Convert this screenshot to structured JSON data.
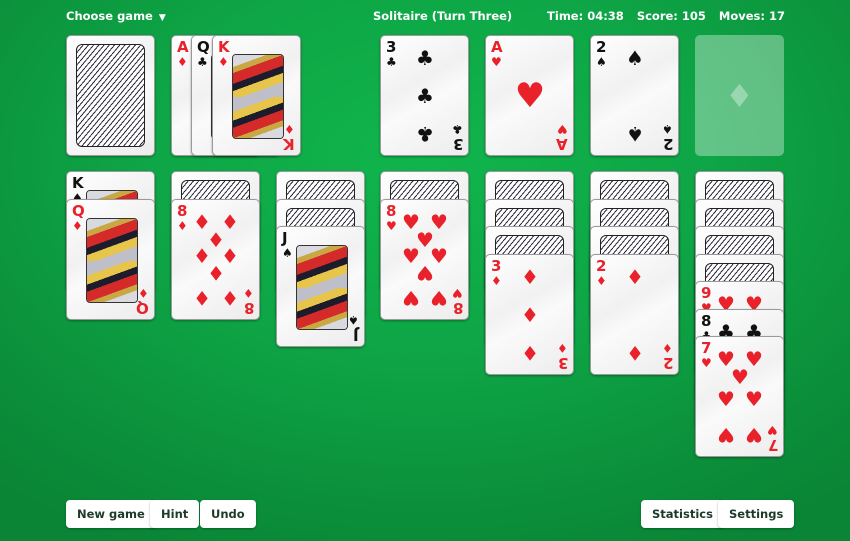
{
  "header": {
    "choose_game_label": "Choose game",
    "choose_game_arrow": "▼",
    "title": "Solitaire (Turn Three)",
    "time": "Time: 04:38",
    "score": "Score: 105",
    "moves": "Moves: 17"
  },
  "stock": {
    "face_down": true
  },
  "waste": [
    {
      "rank": "A",
      "suit": "♦",
      "color": "red"
    },
    {
      "rank": "Q",
      "suit": "♣",
      "color": "black"
    },
    {
      "rank": "K",
      "suit": "♦",
      "color": "red"
    }
  ],
  "foundations": [
    {
      "rank": "3",
      "suit": "♣",
      "color": "black"
    },
    {
      "rank": "A",
      "suit": "♥",
      "color": "red"
    },
    {
      "rank": "2",
      "suit": "♠",
      "color": "black"
    },
    {
      "empty": true,
      "placeholder_suit": "♦"
    }
  ],
  "tableau": [
    {
      "face_down": 0,
      "face_up": [
        {
          "rank": "K",
          "suit": "♠",
          "color": "black"
        },
        {
          "rank": "Q",
          "suit": "♦",
          "color": "red"
        }
      ]
    },
    {
      "face_down": 1,
      "face_up": [
        {
          "rank": "8",
          "suit": "♦",
          "color": "red"
        }
      ]
    },
    {
      "face_down": 2,
      "face_up": [
        {
          "rank": "J",
          "suit": "♠",
          "color": "black"
        }
      ]
    },
    {
      "face_down": 1,
      "face_up": [
        {
          "rank": "8",
          "suit": "♥",
          "color": "red"
        }
      ]
    },
    {
      "face_down": 3,
      "face_up": [
        {
          "rank": "3",
          "suit": "♦",
          "color": "red"
        }
      ]
    },
    {
      "face_down": 3,
      "face_up": [
        {
          "rank": "2",
          "suit": "♦",
          "color": "red"
        }
      ]
    },
    {
      "face_down": 4,
      "face_up": [
        {
          "rank": "9",
          "suit": "♥",
          "color": "red"
        },
        {
          "rank": "8",
          "suit": "♣",
          "color": "black"
        },
        {
          "rank": "7",
          "suit": "♥",
          "color": "red"
        }
      ]
    }
  ],
  "buttons": {
    "new_game": "New game",
    "hint": "Hint",
    "undo": "Undo",
    "statistics": "Statistics",
    "settings": "Settings"
  },
  "colors": {
    "felt": "#0ea546",
    "red_suit": "#e8212b",
    "black_suit": "#111111",
    "button_text": "#1d3a2a"
  }
}
